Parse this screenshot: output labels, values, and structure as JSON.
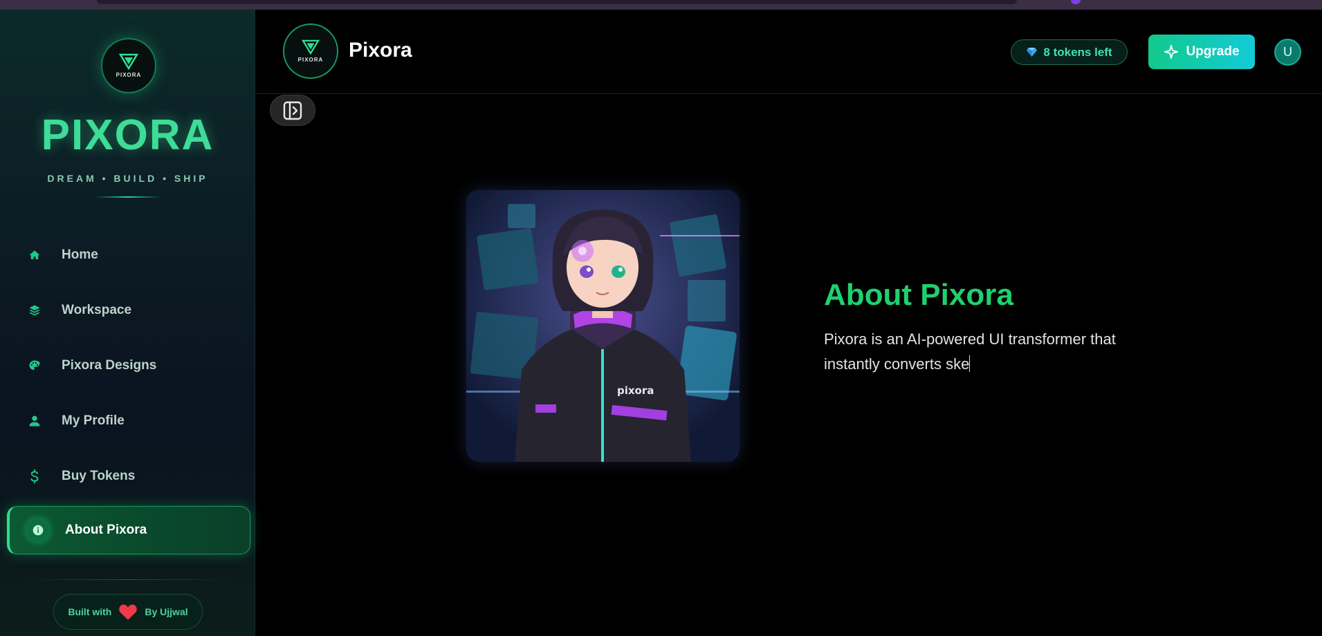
{
  "sidebar": {
    "logo_mini": "PIXORA",
    "brand": "PIXORA",
    "tagline": "DREAM • BUILD • SHIP",
    "items": [
      {
        "label": "Home",
        "icon": "home-icon"
      },
      {
        "label": "Workspace",
        "icon": "layers-icon"
      },
      {
        "label": "Pixora Designs",
        "icon": "palette-icon"
      },
      {
        "label": "My Profile",
        "icon": "user-icon"
      },
      {
        "label": "Buy Tokens",
        "icon": "dollar-icon"
      },
      {
        "label": "About Pixora",
        "icon": "info-icon",
        "active": true
      }
    ],
    "footer": {
      "built": "Built with",
      "by": "By Ujjwal"
    }
  },
  "header": {
    "logo_mini": "PIXORA",
    "title": "Pixora",
    "tokens": "8 tokens left",
    "upgrade": "Upgrade",
    "avatar": "U"
  },
  "main": {
    "about_title": "About Pixora",
    "about_text": "Pixora is an AI-powered UI transformer that instantly converts ske"
  },
  "colors": {
    "accent": "#1fd06e",
    "brand": "#3ddc97",
    "upgrade_start": "#12c98c",
    "upgrade_end": "#13cbd6"
  }
}
